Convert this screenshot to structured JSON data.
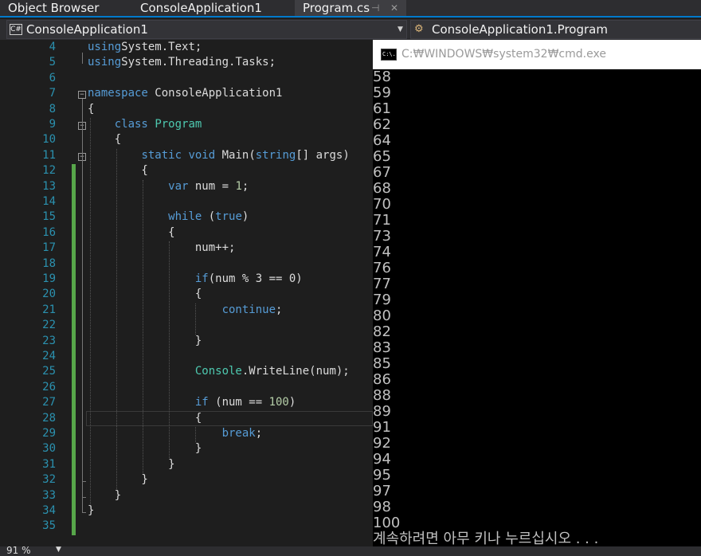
{
  "tabs": [
    {
      "label": "Object Browser",
      "active": false
    },
    {
      "label": "ConsoleApplication1",
      "active": false
    },
    {
      "label": "Program.cs",
      "active": true
    }
  ],
  "tab_icons": {
    "pin": "⊣",
    "close": "✕"
  },
  "navbar": {
    "project": "ConsoleApplication1",
    "project_badge": "C#",
    "type_member": "ConsoleApplication1.Program"
  },
  "code": {
    "lines": [
      {
        "n": "4",
        "tokens": [
          [
            "kw",
            "using"
          ],
          [
            "",
            "System.Text;"
          ]
        ]
      },
      {
        "n": "5",
        "tokens": [
          [
            "kw",
            "using"
          ],
          [
            "",
            "System.Threading.Tasks;"
          ]
        ]
      },
      {
        "n": "6",
        "tokens": []
      },
      {
        "n": "7",
        "tokens": [
          [
            "kw",
            "namespace"
          ],
          [
            "",
            " ConsoleApplication1"
          ]
        ]
      },
      {
        "n": "8",
        "tokens": [
          [
            "",
            "{"
          ]
        ]
      },
      {
        "n": "9",
        "tokens": [
          [
            "",
            "    "
          ],
          [
            "kw",
            "class"
          ],
          [
            "",
            " "
          ],
          [
            "ty",
            "Program"
          ]
        ]
      },
      {
        "n": "10",
        "tokens": [
          [
            "",
            "    {"
          ]
        ]
      },
      {
        "n": "11",
        "tokens": [
          [
            "",
            "        "
          ],
          [
            "kw",
            "static"
          ],
          [
            "",
            " "
          ],
          [
            "kw",
            "void"
          ],
          [
            "",
            " Main("
          ],
          [
            "kw",
            "string"
          ],
          [
            "",
            "[] args)"
          ]
        ]
      },
      {
        "n": "12",
        "tokens": [
          [
            "",
            "        {"
          ]
        ]
      },
      {
        "n": "13",
        "tokens": [
          [
            "",
            "            "
          ],
          [
            "kw",
            "var"
          ],
          [
            "",
            " num = "
          ],
          [
            "num",
            "1"
          ],
          [
            "",
            ";"
          ]
        ]
      },
      {
        "n": "14",
        "tokens": []
      },
      {
        "n": "15",
        "tokens": [
          [
            "",
            "            "
          ],
          [
            "kw",
            "while"
          ],
          [
            "",
            " ("
          ],
          [
            "kw",
            "true"
          ],
          [
            "",
            ")"
          ]
        ]
      },
      {
        "n": "16",
        "tokens": [
          [
            "",
            "            {"
          ]
        ]
      },
      {
        "n": "17",
        "tokens": [
          [
            "",
            "                num++;"
          ]
        ]
      },
      {
        "n": "18",
        "tokens": []
      },
      {
        "n": "19",
        "tokens": [
          [
            "",
            "                "
          ],
          [
            "kw",
            "if"
          ],
          [
            "",
            "(num % 3 == 0)"
          ]
        ]
      },
      {
        "n": "20",
        "tokens": [
          [
            "",
            "                {"
          ]
        ]
      },
      {
        "n": "21",
        "tokens": [
          [
            "",
            "                    "
          ],
          [
            "kw",
            "continue"
          ],
          [
            "",
            ";"
          ]
        ]
      },
      {
        "n": "22",
        "tokens": []
      },
      {
        "n": "23",
        "tokens": [
          [
            "",
            "                }"
          ]
        ]
      },
      {
        "n": "24",
        "tokens": []
      },
      {
        "n": "25",
        "tokens": [
          [
            "",
            "                "
          ],
          [
            "ty",
            "Console"
          ],
          [
            "",
            ".WriteLine(num);"
          ]
        ]
      },
      {
        "n": "26",
        "tokens": []
      },
      {
        "n": "27",
        "tokens": [
          [
            "",
            "                "
          ],
          [
            "kw",
            "if"
          ],
          [
            "",
            " (num == "
          ],
          [
            "num",
            "100"
          ],
          [
            "",
            ")"
          ]
        ]
      },
      {
        "n": "28",
        "tokens": [
          [
            "",
            "                {"
          ]
        ]
      },
      {
        "n": "29",
        "tokens": [
          [
            "",
            "                    "
          ],
          [
            "kw",
            "break"
          ],
          [
            "",
            ";"
          ]
        ]
      },
      {
        "n": "30",
        "tokens": [
          [
            "",
            "                }"
          ]
        ]
      },
      {
        "n": "31",
        "tokens": [
          [
            "",
            "            }"
          ]
        ]
      },
      {
        "n": "32",
        "tokens": [
          [
            "",
            "        }"
          ]
        ]
      },
      {
        "n": "33",
        "tokens": [
          [
            "",
            "    }"
          ]
        ]
      },
      {
        "n": "34",
        "tokens": [
          [
            "",
            "}"
          ]
        ]
      },
      {
        "n": "35",
        "tokens": []
      }
    ]
  },
  "console": {
    "title": "C:₩WINDOWS₩system32₩cmd.exe",
    "icon_label": "C:\\.",
    "output": [
      "58",
      "59",
      "61",
      "62",
      "64",
      "65",
      "67",
      "68",
      "70",
      "71",
      "73",
      "74",
      "76",
      "77",
      "79",
      "80",
      "82",
      "83",
      "85",
      "86",
      "88",
      "89",
      "91",
      "92",
      "94",
      "95",
      "97",
      "98",
      "100",
      "계속하려면 아무 키나 누르십시오 . . ."
    ]
  },
  "status": {
    "zoom": "91 %",
    "zoom_chevron": "▼"
  },
  "colors": {
    "accent": "#007acc",
    "keyword": "#569cd6",
    "type": "#4ec9b0",
    "number": "#b5cea8",
    "line_number": "#2b91af",
    "change_bar": "#57a64a"
  }
}
